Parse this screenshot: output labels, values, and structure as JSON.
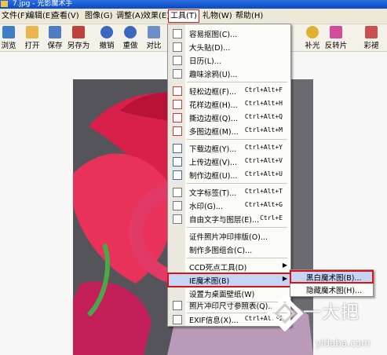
{
  "window": {
    "title": "7.jpg - 光影魔术手"
  },
  "menu": [
    {
      "label": "文件(F)"
    },
    {
      "label": "编辑(E)"
    },
    {
      "label": "查看(V)"
    },
    {
      "label": "图像(G)"
    },
    {
      "label": "调整(A)"
    },
    {
      "label": "效果(E)"
    },
    {
      "label": "工具(T)",
      "active": true
    },
    {
      "label": "礼物(W)"
    },
    {
      "label": "帮助(H)"
    }
  ],
  "toolbar": [
    {
      "label": "浏览",
      "icon": "browse-icon",
      "color": "#3c7fc8"
    },
    {
      "label": "打开",
      "icon": "open-folder-icon",
      "color": "#e8b64a"
    },
    {
      "label": "保存",
      "icon": "save-icon",
      "color": "#4f7dc2"
    },
    {
      "label": "另存为",
      "icon": "save-as-icon",
      "color": "#c0403a"
    },
    {
      "label": "撤销",
      "icon": "undo-icon",
      "color": "#3a68c0"
    },
    {
      "label": "重做",
      "icon": "redo-icon",
      "color": "#3a68c0"
    },
    {
      "label": "对比",
      "icon": "compare-icon",
      "color": "#6b8fc8"
    },
    {
      "label": "补光",
      "icon": "fill-light-icon",
      "color": "#e0b030"
    },
    {
      "label": "反转片",
      "icon": "reversal-film-icon",
      "color": "#d24c9a"
    },
    {
      "label": "彩褪",
      "icon": "color-fade-icon",
      "color": "#c85050"
    }
  ],
  "tools_menu": {
    "items": [
      {
        "label": "容易抠图(C)...",
        "icon": "cutout-icon"
      },
      {
        "label": "大头贴(D)...",
        "icon": "photo-sticker-icon"
      },
      {
        "label": "日历(L)...",
        "icon": "calendar-icon"
      },
      {
        "label": "趣味涂鸦(U)...",
        "icon": "doodle-icon"
      },
      {
        "sep": true
      },
      {
        "label": "轻松边框(F)...",
        "shortcut": "Ctrl+Alt+F",
        "icon": "easy-frame-icon"
      },
      {
        "label": "花样边框(H)...",
        "shortcut": "Ctrl+Alt+H",
        "icon": "pattern-frame-icon"
      },
      {
        "label": "撕边边框(Q)...",
        "shortcut": "Ctrl+Alt+Q",
        "icon": "torn-frame-icon"
      },
      {
        "label": "多图边框(M)...",
        "shortcut": "Ctrl+Alt+M",
        "icon": "multi-frame-icon"
      },
      {
        "sep": true
      },
      {
        "label": "下载边框(Y)...",
        "shortcut": "Ctrl+Alt+Y",
        "icon": "download-frame-icon"
      },
      {
        "label": "上传边框(V)...",
        "shortcut": "Ctrl+Alt+V",
        "icon": "upload-frame-icon"
      },
      {
        "label": "制作边框(U)...",
        "shortcut": "Ctrl+Alt+U",
        "icon": "make-frame-icon"
      },
      {
        "sep": true
      },
      {
        "label": "文字标签(T)...",
        "shortcut": "Ctrl+Alt+T",
        "icon": "text-label-icon"
      },
      {
        "label": "水印(G)...",
        "shortcut": "Ctrl+Alt+G",
        "icon": "watermark-icon"
      },
      {
        "label": "自由文字与图层(E)...",
        "shortcut": "Ctrl+E",
        "icon": "text-layer-icon"
      },
      {
        "sep": true
      },
      {
        "label": "证件照片冲印排版(O)..."
      },
      {
        "label": "制作多图组合(C)..."
      },
      {
        "sep": true
      },
      {
        "label": "CCD死点工具(D)",
        "arrow": true
      },
      {
        "label": "IE魔术图(B)",
        "arrow": true,
        "hover": true
      },
      {
        "label": "设置为桌面壁纸(W)"
      },
      {
        "sep": true
      },
      {
        "label": "照片冲印尺寸参照表(Q)...",
        "icon": "print-size-icon"
      },
      {
        "sep": true
      },
      {
        "label": "EXIF信息(X)...",
        "shortcut": "Ctrl+Alt+I",
        "icon": "exif-icon"
      }
    ]
  },
  "ie_submenu": [
    {
      "label": "黑白魔术图(B)...",
      "hover": true
    },
    {
      "label": "隐藏魔术图(H)..."
    }
  ],
  "watermark": {
    "text": "一大把",
    "url": "yidaba.com"
  }
}
